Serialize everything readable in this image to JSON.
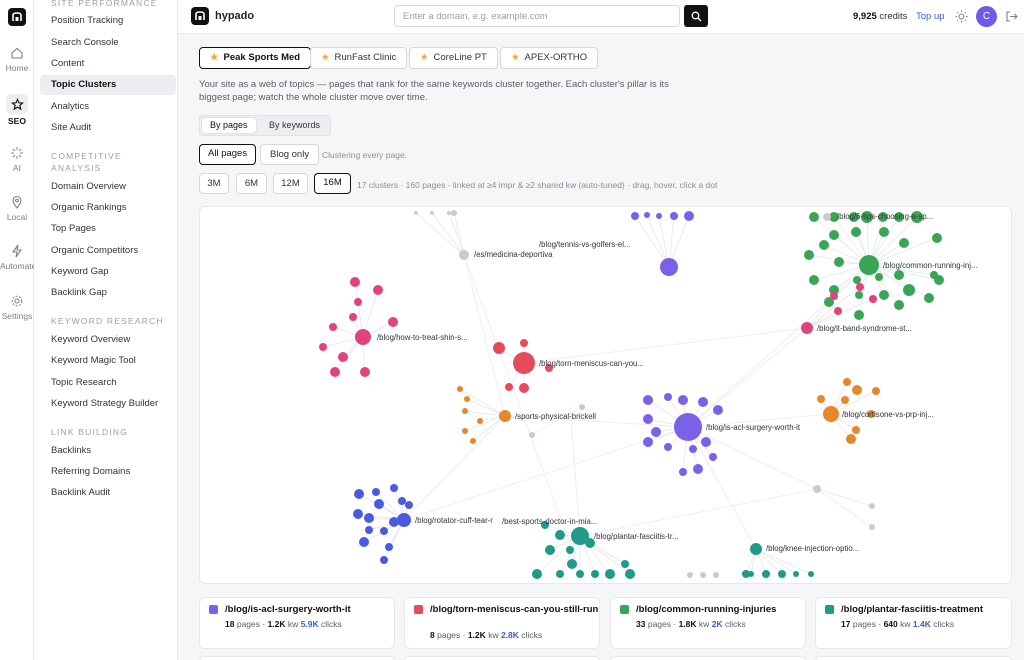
{
  "rail": {
    "items": [
      {
        "label": "Home",
        "icon": "home-icon"
      },
      {
        "label": "SEO",
        "icon": "star-icon",
        "active": true
      },
      {
        "label": "AI",
        "icon": "sparkle-icon"
      },
      {
        "label": "Local",
        "icon": "pin-icon"
      },
      {
        "label": "Automate",
        "icon": "bolt-icon"
      },
      {
        "label": "Settings",
        "icon": "gear-icon"
      }
    ]
  },
  "sidebar": {
    "sections": [
      {
        "title": "SITE PERFORMANCE",
        "items": [
          "Position Tracking",
          "Search Console",
          "Content",
          "Topic Clusters",
          "Analytics",
          "Site Audit"
        ]
      },
      {
        "title": "COMPETITIVE ANALYSIS",
        "items": [
          "Domain Overview",
          "Organic Rankings",
          "Top Pages",
          "Organic Competitors",
          "Keyword Gap",
          "Backlink Gap"
        ]
      },
      {
        "title": "KEYWORD RESEARCH",
        "items": [
          "Keyword Overview",
          "Keyword Magic Tool",
          "Topic Research",
          "Keyword Strategy Builder"
        ]
      },
      {
        "title": "LINK BUILDING",
        "items": [
          "Backlinks",
          "Referring Domains",
          "Backlink Audit"
        ]
      }
    ],
    "active": "Topic Clusters"
  },
  "topbar": {
    "brand": "hypado",
    "search_placeholder": "Enter a domain, e.g. example.com",
    "credits_value": "9,925",
    "credits_label": "credits",
    "topup": "Top up",
    "avatar_letter": "C"
  },
  "projects": [
    "Peak Sports Med",
    "RunFast Clinic",
    "CoreLine PT",
    "APEX-ORTHO"
  ],
  "description": "Your site as a web of topics — pages that rank for the same keywords cluster together. Each cluster's pillar is its biggest page; watch the whole cluster move over time.",
  "view_toggle": {
    "options": [
      "By pages",
      "By keywords"
    ],
    "selected": "By pages"
  },
  "filter": {
    "options": [
      "All pages",
      "Blog only"
    ],
    "selected": "All pages",
    "hint": "Clustering every page."
  },
  "range": {
    "options": [
      "3M",
      "6M",
      "12M",
      "16M"
    ],
    "selected": "16M",
    "summary": "17 clusters · 160 pages · linked at ≥4 impr & ≥2 shared kw (auto-tuned) · drag, hover, click a dot"
  },
  "clusters_graph": {
    "labels": [
      "/blog/tennis-vs-golfers-el...",
      "/es/medicina-deportiva",
      "/blog/common-running-inj...",
      "/blog/6-tips-choosing-a-sp...",
      "/blog/it-band-syndrome-st...",
      "/blog/how-to-treat-shin-s...",
      "/blog/torn-meniscus-can-you...",
      "/blog/cortisone-vs-prp-inj...",
      "/sports-physical-brickell",
      "/blog/is-acl-surgery-worth-it",
      "/blog/rotator-cuff-tear-r",
      "/best-sports-doctor-in-mia...",
      "/blog/plantar-fasciitis-tr...",
      "/blog/knee-injection-optio..."
    ],
    "colors": {
      "green": "#3aa655",
      "purple": "#7b61e8",
      "pink": "#e0447c",
      "red": "#e54b5a",
      "orange": "#e8862a",
      "blue": "#4a5be0",
      "teal": "#1e9a86",
      "grey": "#c8ccd2"
    }
  },
  "cluster_cards": [
    {
      "title": "/blog/is-acl-surgery-worth-it",
      "color": "#7b61e8",
      "pages": "18",
      "kw": "1.2K",
      "clicks": "5.9K"
    },
    {
      "title": "/blog/torn-meniscus-can-you-still-run",
      "color": "#e54b5a",
      "pages": "8",
      "kw": "1.2K",
      "clicks": "2.8K"
    },
    {
      "title": "/blog/common-running-injuries",
      "color": "#3aa655",
      "pages": "33",
      "kw": "1.8K",
      "clicks": "2K"
    },
    {
      "title": "/blog/plantar-fasciitis-treatment",
      "color": "#1e9a86",
      "pages": "17",
      "kw": "640",
      "clicks": "1.4K"
    }
  ],
  "card_units": {
    "pages": "pages",
    "kw": "kw",
    "clicks": "clicks"
  }
}
